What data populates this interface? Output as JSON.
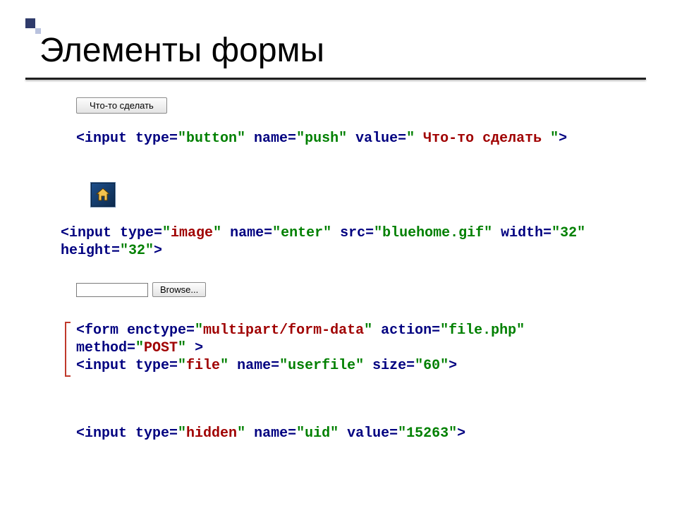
{
  "title": "Элементы формы",
  "examples": {
    "button": {
      "label": " Что-то сделать ",
      "code_html": "<span class='navy'>&lt;input type=</span><span class='str'>\"button\"</span><span class='navy'> name=</span><span class='str'>\"push\"</span><span class='navy'> value=</span><span class='str'>\" </span><span class='kw'>Что-то сделать </span><span class='str'>\"</span><span class='navy'>&gt;</span>"
    },
    "image": {
      "code_html": "<span class='navy'>&lt;input type=</span><span class='str'>\"</span><span class='kw'>image</span><span class='str'>\"</span><span class='navy'> name=</span><span class='str'>\"enter\"</span><span class='navy'> src=</span><span class='str'>\"bluehome.gif\"</span><span class='navy'> width=</span><span class='str'>\"32\"</span><span class='navy'> height=</span><span class='str'>\"32\"</span><span class='navy'>&gt;</span>"
    },
    "file": {
      "browse_label": "Browse...",
      "code_html": "<span class='navy'>&lt;form enctype=</span><span class='str'>\"</span><span class='kw'>multipart/form-data</span><span class='str'>\"</span><span class='navy'> action=</span><span class='str'>\"file.php\"</span><span class='navy'> method=</span><span class='str'>\"</span><span class='kw'>POST</span><span class='str'>\" </span><span class='navy'>&gt;</span>\n<span class='navy'>&lt;input type=</span><span class='str'>\"</span><span class='kw'>file</span><span class='str'>\"</span><span class='navy'> name=</span><span class='str'>\"userfile\"</span><span class='navy'> size=</span><span class='str'>\"60\"</span><span class='navy'>&gt;</span>"
    },
    "hidden": {
      "code_html": "<span class='navy'>&lt;input type=</span><span class='str'>\"</span><span class='kw'>hidden</span><span class='str'>\"</span><span class='navy'> name=</span><span class='str'>\"uid\"</span><span class='navy'> value=</span><span class='str'>\"15263\"</span><span class='navy'>&gt;</span>"
    }
  }
}
